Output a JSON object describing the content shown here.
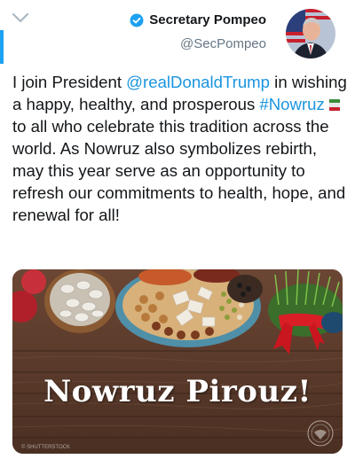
{
  "header": {
    "display_name": "Secretary Pompeo",
    "handle": "@SecPompeo"
  },
  "tweet": {
    "t1": "I join President ",
    "mention": "@realDonaldTrump",
    "t2": " in wishing a happy, healthy, and prosperous ",
    "hashtag": "#Nowruz",
    "t3": " to all who celebrate this tradition across the world. As Nowruz also symbolizes rebirth, may this year serve as an opportunity to refresh our commitments to health, hope, and renewal for all!"
  },
  "media": {
    "banner_text": "Nowruz Pirouz!",
    "watermark": "© SHUTTERSTOCK"
  },
  "colors": {
    "accent": "#1da1f2",
    "link": "#1b95e0",
    "text": "#14171a",
    "secondary": "#657786"
  },
  "icons": [
    "chevron-down-icon",
    "verified-badge-icon",
    "book-emoji-icon",
    "state-department-seal-icon"
  ]
}
